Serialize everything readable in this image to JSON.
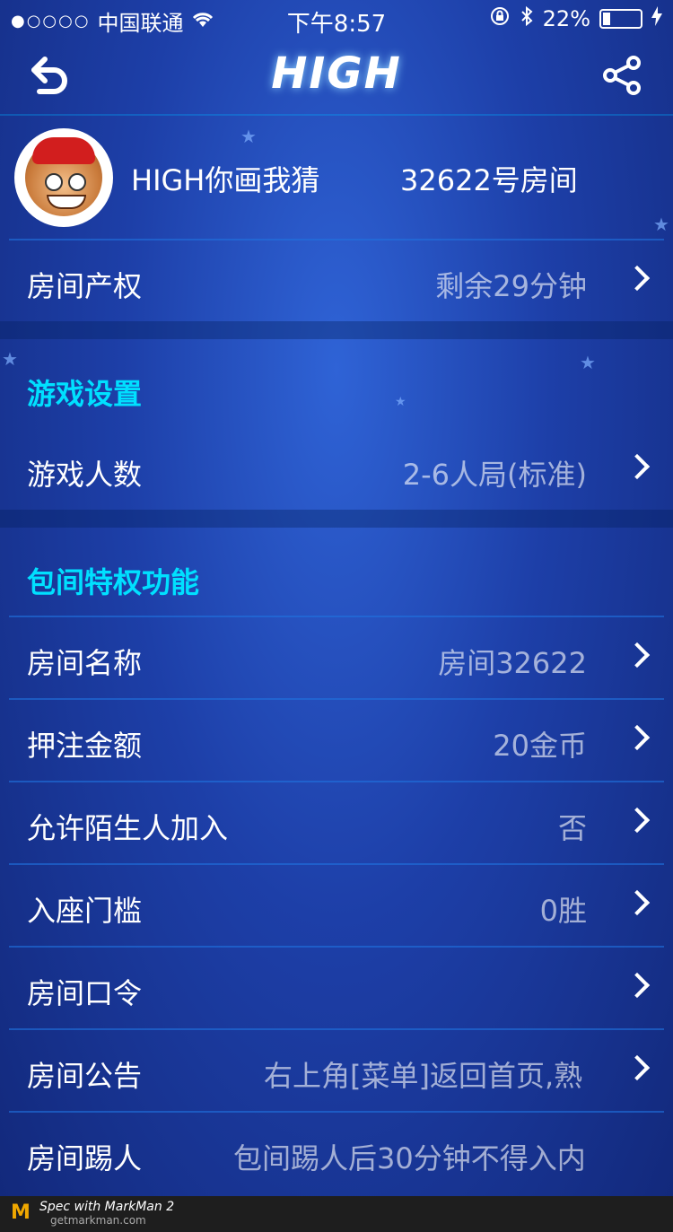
{
  "status_bar": {
    "signal_dots": "●○○○○",
    "carrier": "中国联通",
    "wifi_icon": "wifi-icon",
    "time": "下午8:57",
    "lock_icon": "rotation-lock-icon",
    "bluetooth_icon": "bluetooth-icon",
    "battery": "22%",
    "battery_level": 0.22
  },
  "nav": {
    "title": "HIGH",
    "back_icon": "back-arrow-icon",
    "share_icon": "share-icon"
  },
  "room": {
    "game_name": "HIGH你画我猜",
    "room_number": "32622号房间"
  },
  "ownership": {
    "label": "房间产权",
    "value": "剩余29分钟"
  },
  "game_settings": {
    "heading": "游戏设置",
    "rows": [
      {
        "label": "游戏人数",
        "value": "2-6人局(标准)"
      }
    ]
  },
  "privileges": {
    "heading": "包间特权功能",
    "rows": [
      {
        "label": "房间名称",
        "value": "房间32622"
      },
      {
        "label": "押注金额",
        "value": "20金币"
      },
      {
        "label": "允许陌生人加入",
        "value": "否"
      },
      {
        "label": "入座门槛",
        "value": "0胜"
      },
      {
        "label": "房间口令",
        "value": ""
      },
      {
        "label": "房间公告",
        "value": "右上角[菜单]返回首页,熟"
      },
      {
        "label": "房间踢人",
        "value": "包间踢人后30分钟不得入内"
      }
    ]
  },
  "footer": {
    "brand_line": "Spec with MarkMan 2",
    "url": "getmarkman.com"
  },
  "colors": {
    "accent_heading": "#00e0ff",
    "divider": "#00aeff",
    "band": "#031f5c"
  }
}
